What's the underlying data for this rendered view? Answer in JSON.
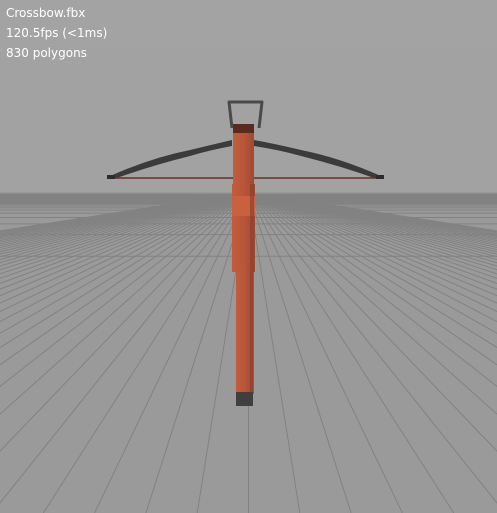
{
  "viewer": {
    "file_name": "Crossbow.fbx",
    "fps_readout": "120.5fps (<1ms)",
    "polygon_readout": "830 polygons"
  },
  "scene": {
    "background_color": "#a1a1a1",
    "ground_color": "#9a9a9a",
    "grid_line_color": "#808080",
    "model_wood_color": "#b85537",
    "model_dark_color": "#3a3a3a",
    "model_string_color": "#6b2f1f"
  }
}
